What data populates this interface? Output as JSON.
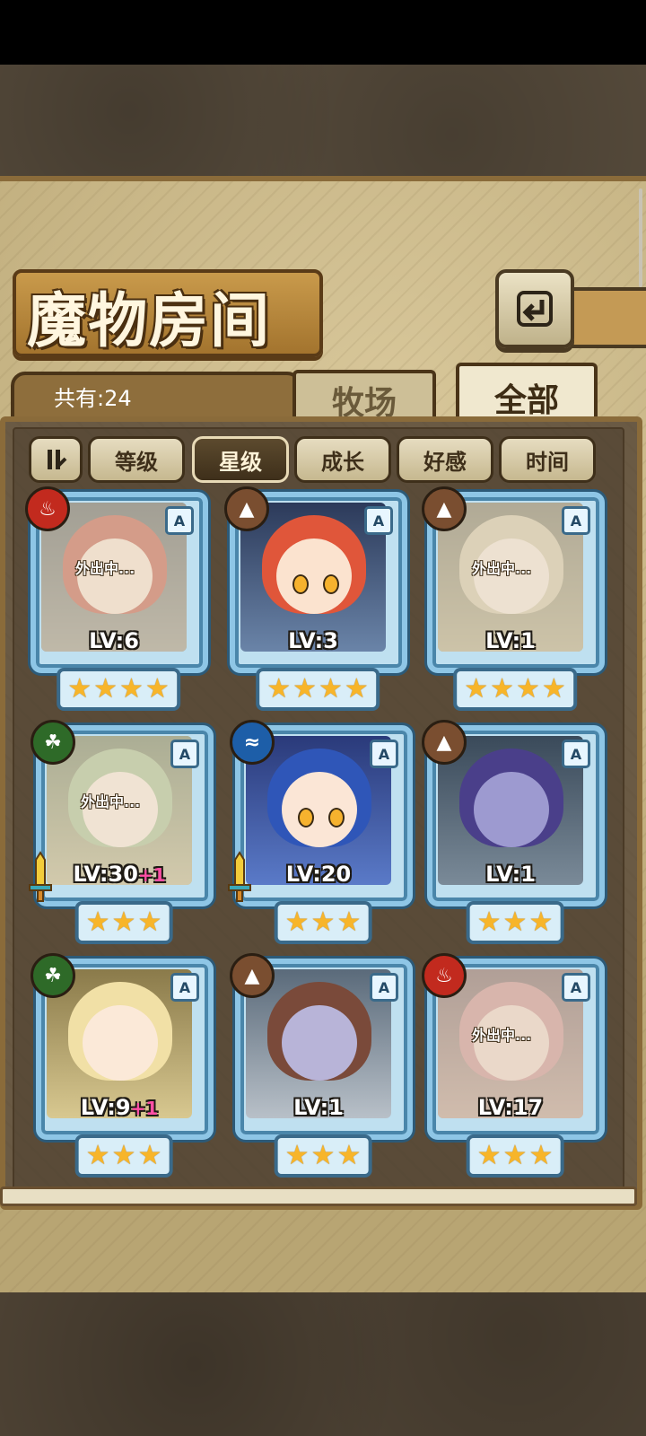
{
  "header": {
    "title": "魔物房间",
    "back_icon": "back-arrow-icon"
  },
  "tabs": {
    "count_label": "共有:24",
    "pasture": "牧场",
    "all": "全部"
  },
  "filters": {
    "toggle_icon": "sort-toggle-icon",
    "items": [
      "等级",
      "星级",
      "成长",
      "好感",
      "时间"
    ],
    "active": "星级"
  },
  "monsters": [
    {
      "element": "fire",
      "rank": "A",
      "level": "LV:6",
      "bonus": "",
      "stars": 4,
      "status": "外出中...",
      "equipped": false
    },
    {
      "element": "earth",
      "rank": "A",
      "level": "LV:3",
      "bonus": "",
      "stars": 4,
      "status": "",
      "equipped": false
    },
    {
      "element": "earth",
      "rank": "A",
      "level": "LV:1",
      "bonus": "",
      "stars": 4,
      "status": "外出中...",
      "equipped": false
    },
    {
      "element": "wood",
      "rank": "A",
      "level": "LV:30",
      "bonus": "+1",
      "stars": 3,
      "status": "外出中...",
      "equipped": true
    },
    {
      "element": "water",
      "rank": "A",
      "level": "LV:20",
      "bonus": "",
      "stars": 3,
      "status": "",
      "equipped": true
    },
    {
      "element": "earth",
      "rank": "A",
      "level": "LV:1",
      "bonus": "",
      "stars": 3,
      "status": "",
      "equipped": false
    },
    {
      "element": "wood",
      "rank": "A",
      "level": "LV:9",
      "bonus": "+1",
      "stars": 3,
      "status": "",
      "equipped": false
    },
    {
      "element": "earth",
      "rank": "A",
      "level": "LV:1",
      "bonus": "",
      "stars": 3,
      "status": "",
      "equipped": false
    },
    {
      "element": "fire",
      "rank": "A",
      "level": "LV:17",
      "bonus": "",
      "stars": 3,
      "status": "外出中...",
      "equipped": false
    }
  ],
  "colors": {
    "fire": "#c22a1e",
    "earth": "#7a4e30",
    "wood": "#2e6a28",
    "water": "#1d5ea8",
    "star": "#f7b52a",
    "card_frame": "#8ec6e6",
    "level_bonus": "#ff4fa5"
  }
}
